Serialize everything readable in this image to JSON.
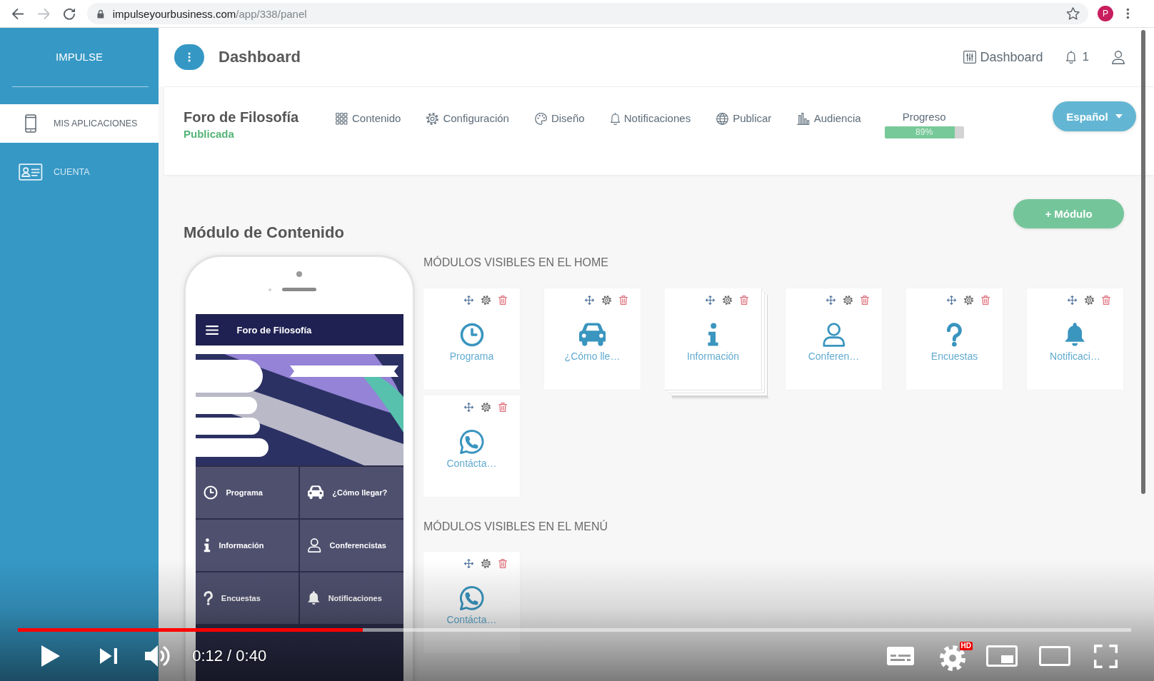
{
  "browser": {
    "forward_disabled": true,
    "url_host": "impulseyourbusiness.com",
    "url_path": "/app/338/panel",
    "profile_initial": "P"
  },
  "sidebar": {
    "logo": "IMPULSE",
    "items": [
      {
        "label": "MIS APLICACIONES",
        "kind": "apps",
        "selected": true
      },
      {
        "label": "CUENTA",
        "kind": "account",
        "selected": false
      }
    ]
  },
  "topbar": {
    "title": "Dashboard",
    "dashboard_link": "Dashboard",
    "notification_count": "1"
  },
  "app_header": {
    "name": "Foro de Filosofía",
    "status": "Publicada",
    "tabs": [
      {
        "label": "Contenido",
        "kind": "content"
      },
      {
        "label": "Configuración",
        "kind": "settings"
      },
      {
        "label": "Diseño",
        "kind": "design"
      },
      {
        "label": "Notificaciones",
        "kind": "notifications"
      },
      {
        "label": "Publicar",
        "kind": "publish"
      },
      {
        "label": "Audiencia",
        "kind": "audience"
      }
    ],
    "progress": {
      "label": "Progreso",
      "level": 0.89,
      "reading": "89%"
    },
    "language": "Español"
  },
  "content": {
    "title": "Módulo de Contenido",
    "add_button": "+ Módulo",
    "phone_preview": {
      "app_title": "Foro de Filosofía",
      "tiles": [
        {
          "label": "Programa",
          "kind": "schedule"
        },
        {
          "label": "¿Cómo llegar?",
          "kind": "directions"
        },
        {
          "label": "Información",
          "kind": "info"
        },
        {
          "label": "Conferencistas",
          "kind": "speakers"
        },
        {
          "label": "Encuestas",
          "kind": "survey"
        },
        {
          "label": "Notificaciones",
          "kind": "notifications"
        }
      ]
    },
    "home_modules": {
      "heading": "MÓDULOS VISIBLES EN EL HOME",
      "modules": [
        {
          "label": "Programa",
          "kind": "schedule",
          "dragging": false
        },
        {
          "label": "¿Cómo lle…",
          "kind": "directions",
          "dragging": false
        },
        {
          "label": "Información",
          "kind": "info",
          "dragging": true
        },
        {
          "label": "Conferen…",
          "kind": "speakers",
          "dragging": false
        },
        {
          "label": "Encuestas",
          "kind": "survey",
          "dragging": false
        },
        {
          "label": "Notificaci…",
          "kind": "notifications",
          "dragging": false
        },
        {
          "label": "Contácta…",
          "kind": "contact",
          "dragging": false
        }
      ]
    },
    "menu_modules": {
      "heading": "MÓDULOS VISIBLES EN EL MENÚ",
      "modules": [
        {
          "label": "Contácta…",
          "kind": "contact",
          "dragging": false
        }
      ]
    }
  },
  "video_player": {
    "level": 0.31,
    "time": "0:12 / 0:40",
    "badge": "HD"
  }
}
